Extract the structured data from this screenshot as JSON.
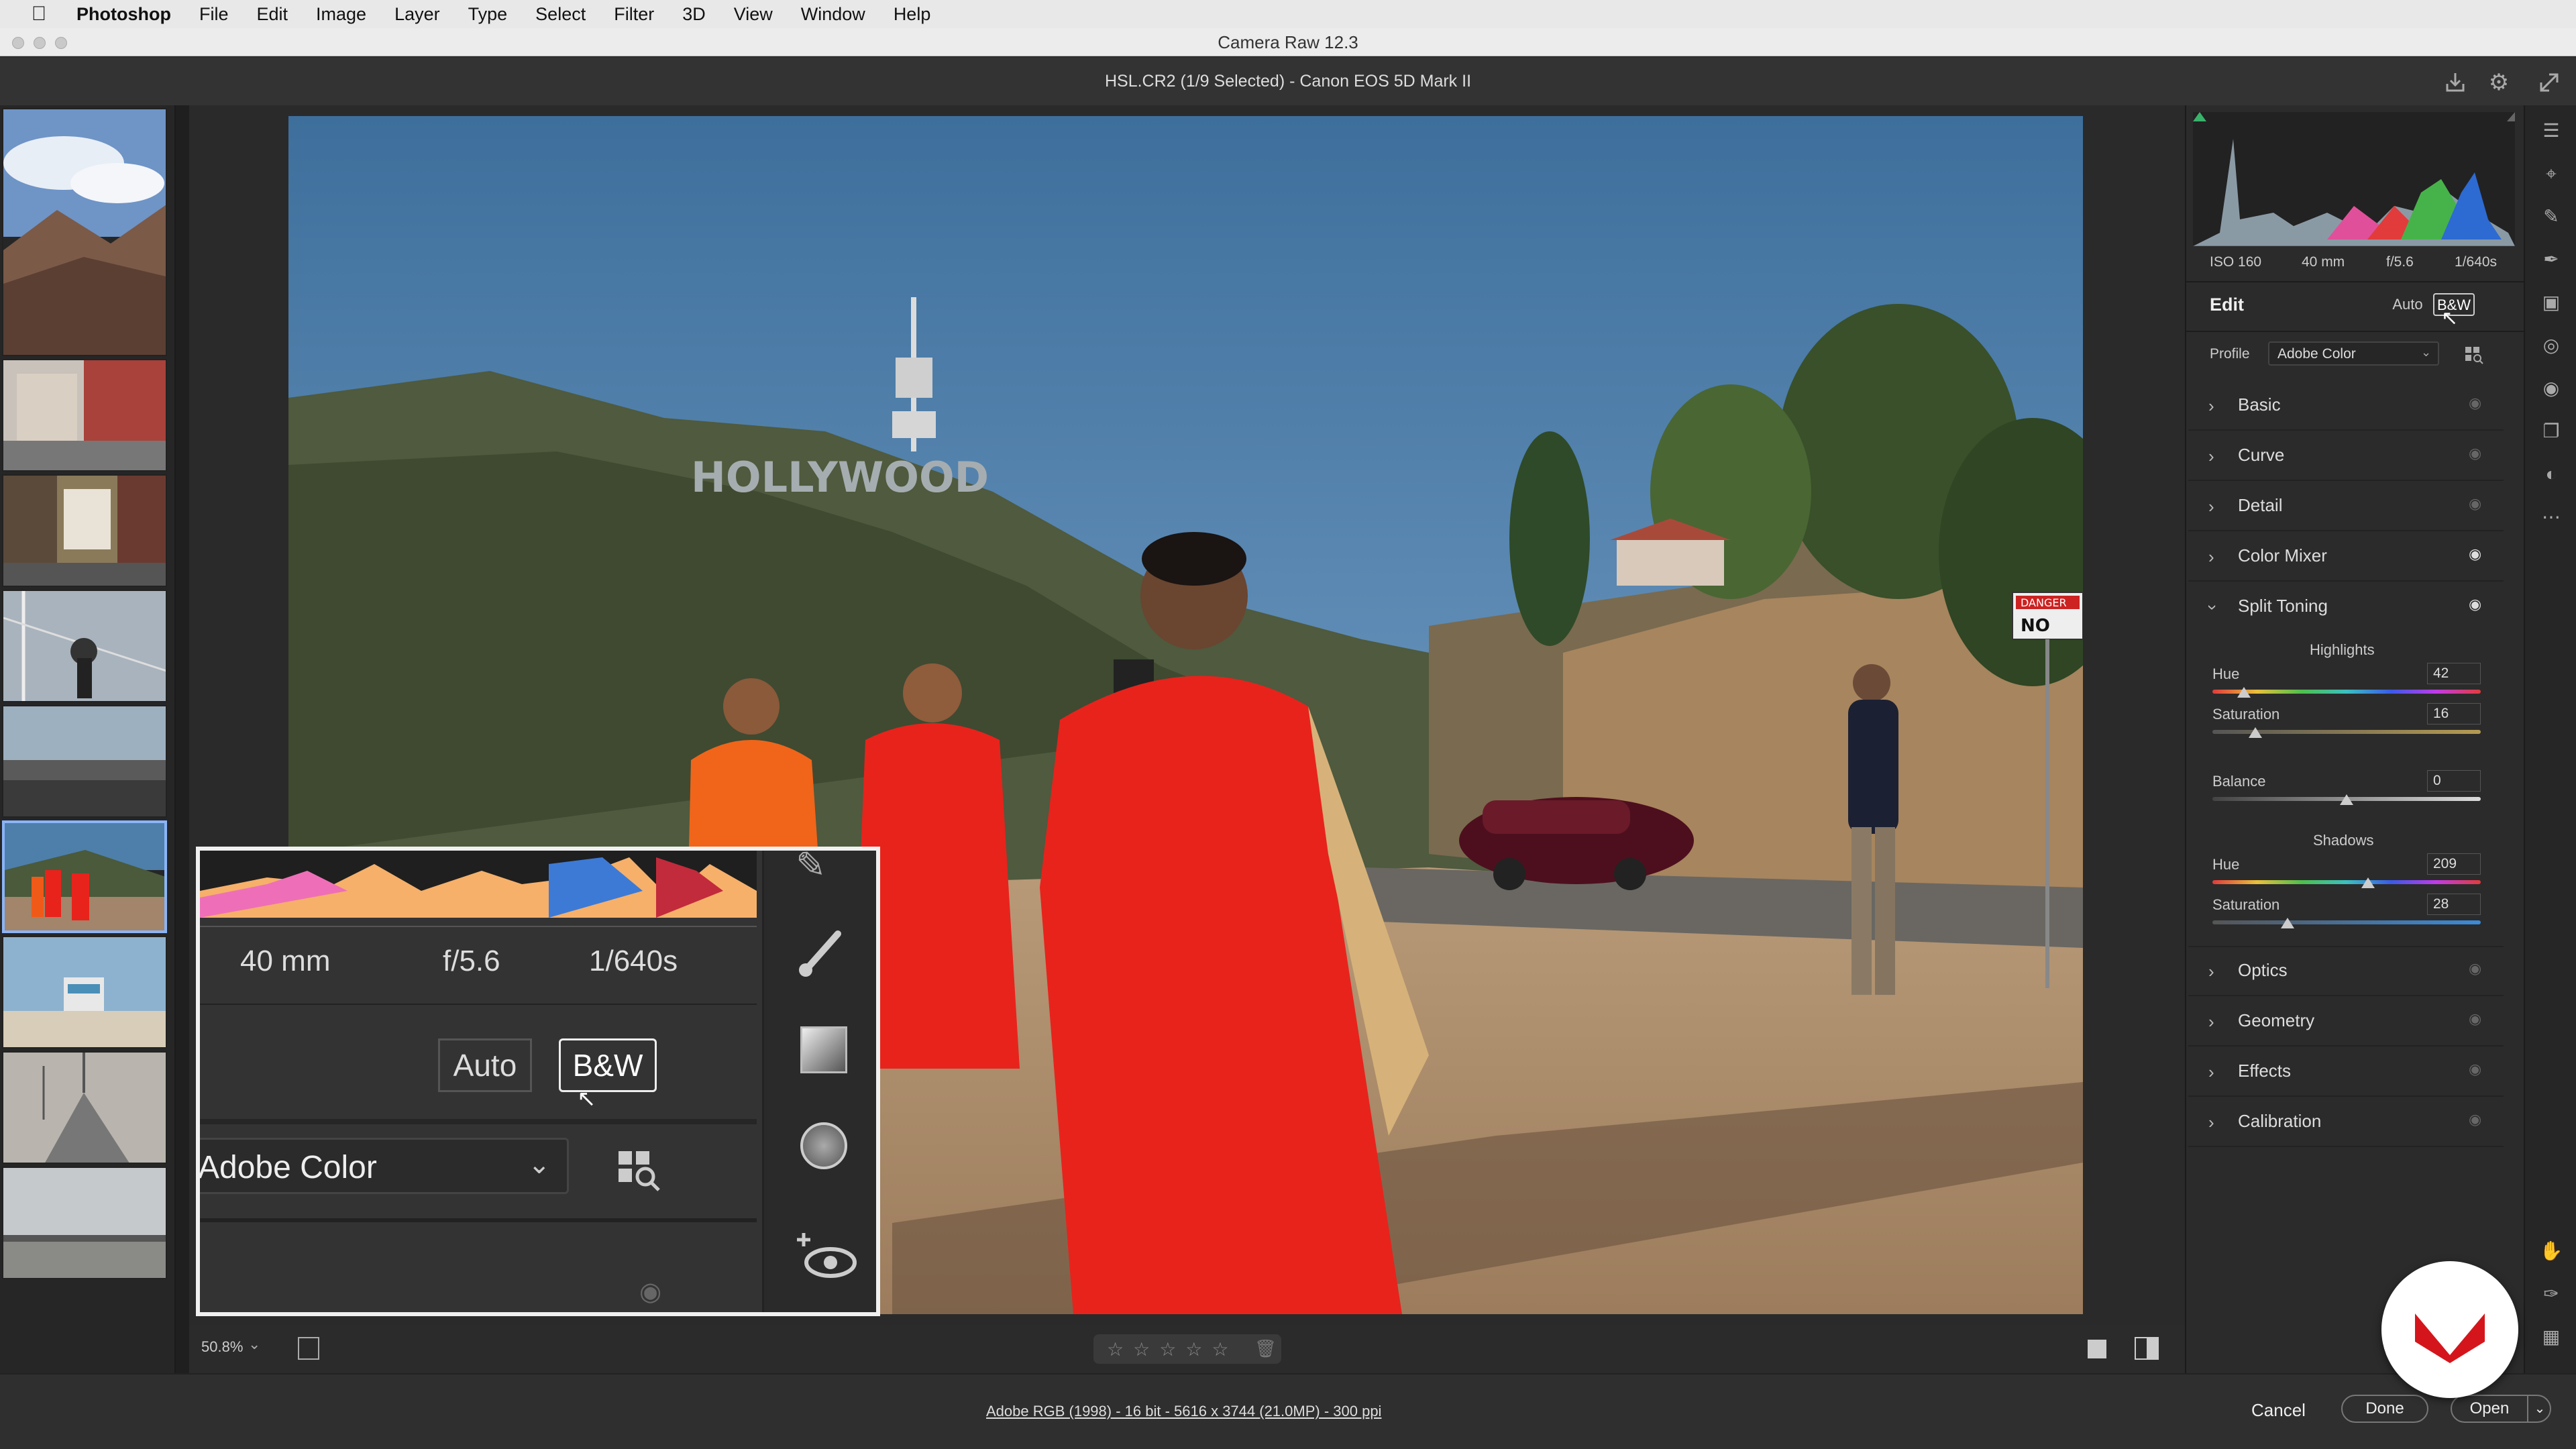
{
  "menubar": {
    "app": "Photoshop",
    "items": [
      "File",
      "Edit",
      "Image",
      "Layer",
      "Type",
      "Select",
      "Filter",
      "3D",
      "View",
      "Window",
      "Help"
    ]
  },
  "window": {
    "title": "Camera Raw 12.3"
  },
  "doc": {
    "title": "HSL.CR2 (1/9 Selected)  -  Canon EOS 5D Mark II"
  },
  "camera": {
    "iso": "ISO 160",
    "focal": "40 mm",
    "aperture": "f/5.6",
    "shutter": "1/640s"
  },
  "edit": {
    "title": "Edit",
    "auto": "Auto",
    "bw": "B&W"
  },
  "profile": {
    "label": "Profile",
    "value": "Adobe Color"
  },
  "sections": {
    "basic": "Basic",
    "curve": "Curve",
    "detail": "Detail",
    "color_mixer": "Color Mixer",
    "split_toning": "Split Toning",
    "optics": "Optics",
    "geometry": "Geometry",
    "effects": "Effects",
    "calibration": "Calibration"
  },
  "split_toning": {
    "highlights_title": "Highlights",
    "shadows_title": "Shadows",
    "hue_label": "Hue",
    "saturation_label": "Saturation",
    "balance_label": "Balance",
    "highlights_hue": "42",
    "highlights_saturation": "16",
    "balance": "0",
    "shadows_hue": "209",
    "shadows_saturation": "28",
    "highlights_hue_frac": 0.117,
    "highlights_saturation_frac": 0.16,
    "balance_frac": 0.5,
    "shadows_hue_frac": 0.58,
    "shadows_saturation_frac": 0.28
  },
  "zoom_inset": {
    "focal": "40 mm",
    "aperture": "f/5.6",
    "shutter": "1/640s",
    "auto": "Auto",
    "bw": "B&W",
    "profile": "Adobe Color"
  },
  "photo": {
    "sign": "HOLLYWOOD",
    "danger": "DANGER",
    "no": "NO"
  },
  "bottom": {
    "zoom": "50.8%"
  },
  "status": {
    "info": "Adobe RGB (1998) - 16 bit - 5616 x 3744 (21.0MP) - 300 ppi",
    "cancel": "Cancel",
    "done": "Done",
    "open": "Open"
  },
  "colors": {
    "accent": "#8ab4f8",
    "red_robe": "#e8231c",
    "sky": "#4d7faa",
    "brand": "#d4161c"
  }
}
